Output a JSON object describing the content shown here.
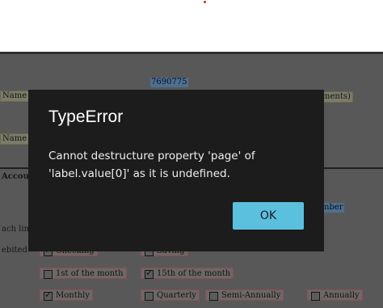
{
  "dialog": {
    "title": "TypeError",
    "message": "Cannot destructure property 'page' of 'label.value[0]' as it is undefined.",
    "ok_label": "OK",
    "button_color": "#5bc0de"
  },
  "background_form": {
    "field_number": "7690775",
    "labels": {
      "name_1": "Name",
      "attachments": "ments)",
      "name_2": "Name",
      "account": "Accoun",
      "number": "mber",
      "each_line": "ach line",
      "debited": "ebited"
    },
    "options": {
      "checking": "Checking",
      "saving": "Saving",
      "first_of_month": "1st of the month",
      "fifteenth_of_month": "15th of the month",
      "monthly": "Monthly",
      "quarterly": "Quarterly",
      "semi_annually": "Semi-Annually",
      "annually": "Annually"
    }
  }
}
